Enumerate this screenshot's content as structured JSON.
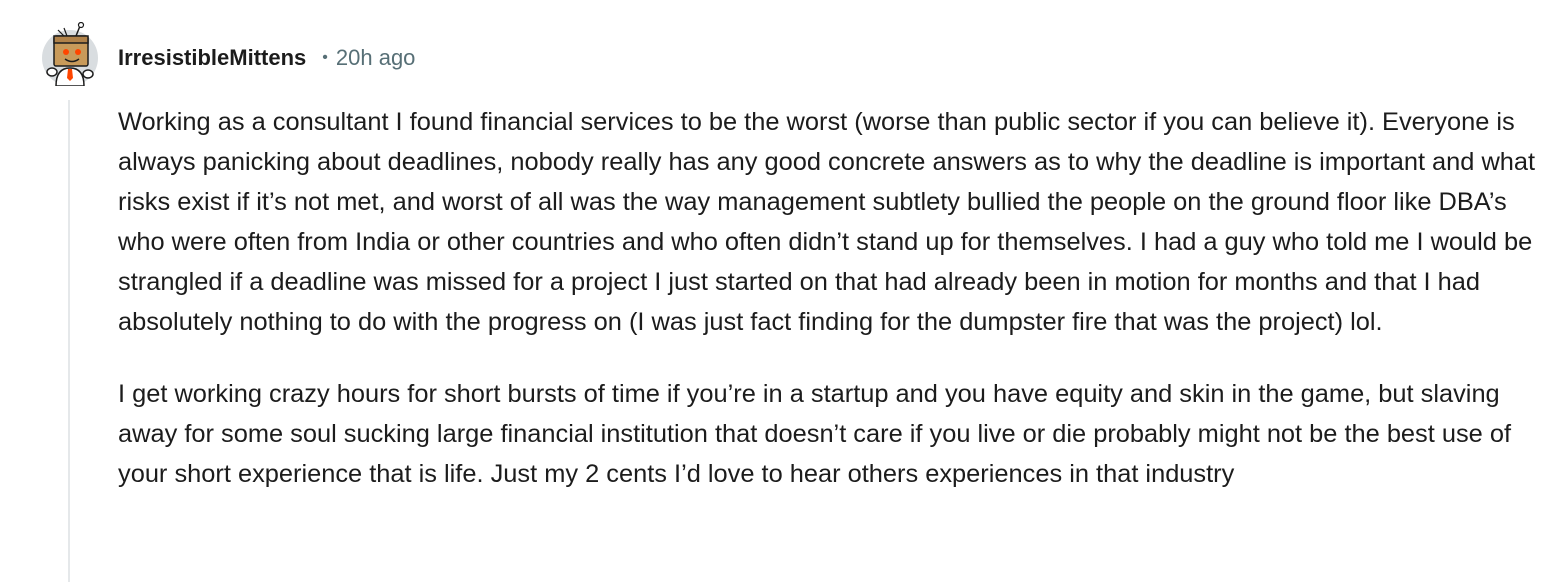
{
  "comment": {
    "author": "IrresistibleMittens",
    "separator": "•",
    "timestamp": "20h ago",
    "avatar_icon": "snoo-box-head-avatar-icon",
    "paragraphs": [
      "Working as a consultant I found financial services to be the worst (worse than public sector if you can believe it). Everyone is always panicking about deadlines, nobody really has any good concrete answers as to why the deadline is important and what risks exist if it’s not met, and worst of all was the way management subtlety bullied the people on the ground floor like DBA’s who were often from India or other countries and who often didn’t stand up for themselves. I had a guy who told me I would be strangled if a deadline was missed for a project I just started on that had already been in motion for months and that I had absolutely nothing to do with the progress on (I was just fact finding for the dumpster fire that was the project) lol.",
      "I get working crazy hours for short bursts of time if you’re in a startup and you have equity and skin in the game, but slaving away for some soul sucking large financial institution that doesn’t care if you live or die probably might not be the best use of your short experience that is life. Just my 2 cents I’d love to hear others experiences in that industry"
    ]
  },
  "colors": {
    "text": "#1c1c1c",
    "meta": "#576f76",
    "thread_line": "#e5e8ea",
    "avatar_bg": "#d9dde0",
    "box_head": "#c89a5a",
    "snoo_accent": "#ff4500"
  }
}
